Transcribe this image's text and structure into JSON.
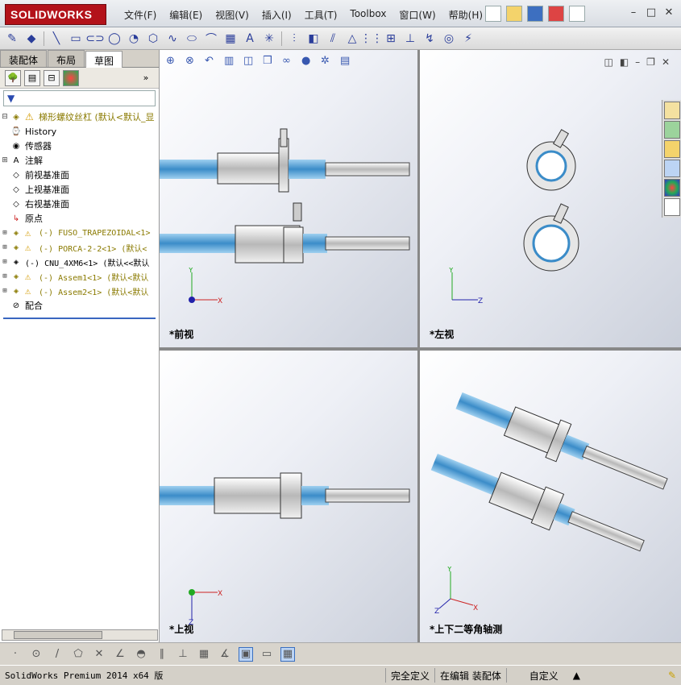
{
  "app": {
    "brand": "SOLIDWORKS",
    "brand_prefix": "DS"
  },
  "menu": [
    "文件(F)",
    "编辑(E)",
    "视图(V)",
    "插入(I)",
    "工具(T)",
    "Toolbox",
    "窗口(W)",
    "帮助(H)"
  ],
  "panel": {
    "tabs": [
      "装配体",
      "布局",
      "草图"
    ],
    "active_tab": "草图",
    "filter": "▼",
    "tree": [
      {
        "label": "梯形螺纹丝杠  (默认<默认_显",
        "warn": true,
        "icon": "assembly-icon"
      },
      {
        "label": "History",
        "icon": "history-icon"
      },
      {
        "label": "传感器",
        "icon": "sensor-icon"
      },
      {
        "label": "注解",
        "icon": "annotation-icon",
        "expand": true
      },
      {
        "label": "前视基准面",
        "icon": "plane-icon"
      },
      {
        "label": "上视基准面",
        "icon": "plane-icon"
      },
      {
        "label": "右视基准面",
        "icon": "plane-icon"
      },
      {
        "label": "原点",
        "icon": "origin-icon"
      },
      {
        "label": "(-) FUSO_TRAPEZOIDAL<1>",
        "warn": true,
        "expand": true,
        "icon": "part-icon"
      },
      {
        "label": "(-) PORCA-2-2<1> (默认<",
        "warn": true,
        "expand": true,
        "icon": "part-icon"
      },
      {
        "label": "(-) CNU_4XM6<1> (默认<<默认",
        "expand": true,
        "icon": "part-icon"
      },
      {
        "label": "(-) Assem1<1> (默认<默认",
        "warn": true,
        "expand": true,
        "icon": "subassembly-icon"
      },
      {
        "label": "(-) Assem2<1> (默认<默认",
        "warn": true,
        "expand": true,
        "icon": "subassembly-icon"
      },
      {
        "label": "配合",
        "icon": "mates-icon"
      }
    ]
  },
  "views": {
    "front": "*前视",
    "left": "*左视",
    "top": "*上视",
    "iso": "*上下二等角轴测"
  },
  "status": {
    "product": "SolidWorks Premium 2014 x64 版",
    "definition": "完全定义",
    "editing": "在编辑 装配体",
    "custom": "自定义"
  }
}
